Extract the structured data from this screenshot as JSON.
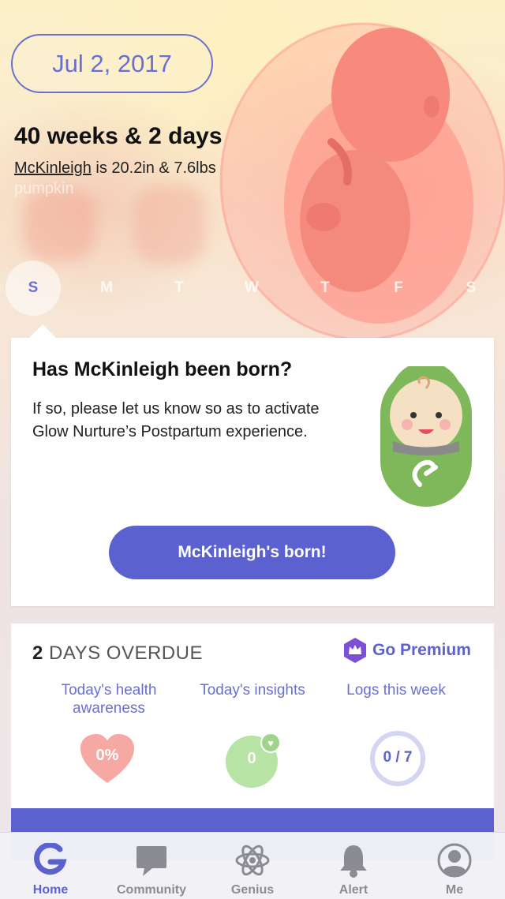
{
  "header": {
    "date": "Jul 2, 2017",
    "weeks": "40 weeks & 2 days",
    "baby_name": "McKinleigh",
    "size_text": " is 20.2in & 7.6lbs",
    "compare_text": "pumpkin"
  },
  "weekdays": [
    {
      "label": "S",
      "active": true
    },
    {
      "label": "M",
      "active": false
    },
    {
      "label": "T",
      "active": false
    },
    {
      "label": "W",
      "active": false
    },
    {
      "label": "T",
      "active": false
    },
    {
      "label": "F",
      "active": false
    },
    {
      "label": "S",
      "active": false
    }
  ],
  "born_card": {
    "title": "Has McKinleigh been born?",
    "body": "If so, please let us know so as to activate Glow Nurture’s Postpartum experience.",
    "button_label": "McKinleigh's born!"
  },
  "status_card": {
    "overdue_number": "2",
    "overdue_text": " DAYS OVERDUE",
    "premium_label": "Go Premium",
    "metrics": [
      {
        "label": "Today's health awareness",
        "value": "0%"
      },
      {
        "label": "Today's insights",
        "value": "0"
      },
      {
        "label": "Logs this week",
        "value": "0 / 7"
      }
    ]
  },
  "tabbar": {
    "tabs": [
      {
        "label": "Home",
        "icon": "glow-logo-icon",
        "active": true
      },
      {
        "label": "Community",
        "icon": "chat-bubble-icon",
        "active": false
      },
      {
        "label": "Genius",
        "icon": "atom-icon",
        "active": false
      },
      {
        "label": "Alert",
        "icon": "bell-icon",
        "active": false
      },
      {
        "label": "Me",
        "icon": "profile-icon",
        "active": false
      }
    ]
  },
  "colors": {
    "accent": "#5b62cf",
    "heart": "#f6a9a2",
    "insight": "#b7e3a5",
    "baby_badge": "#7fb85a"
  }
}
